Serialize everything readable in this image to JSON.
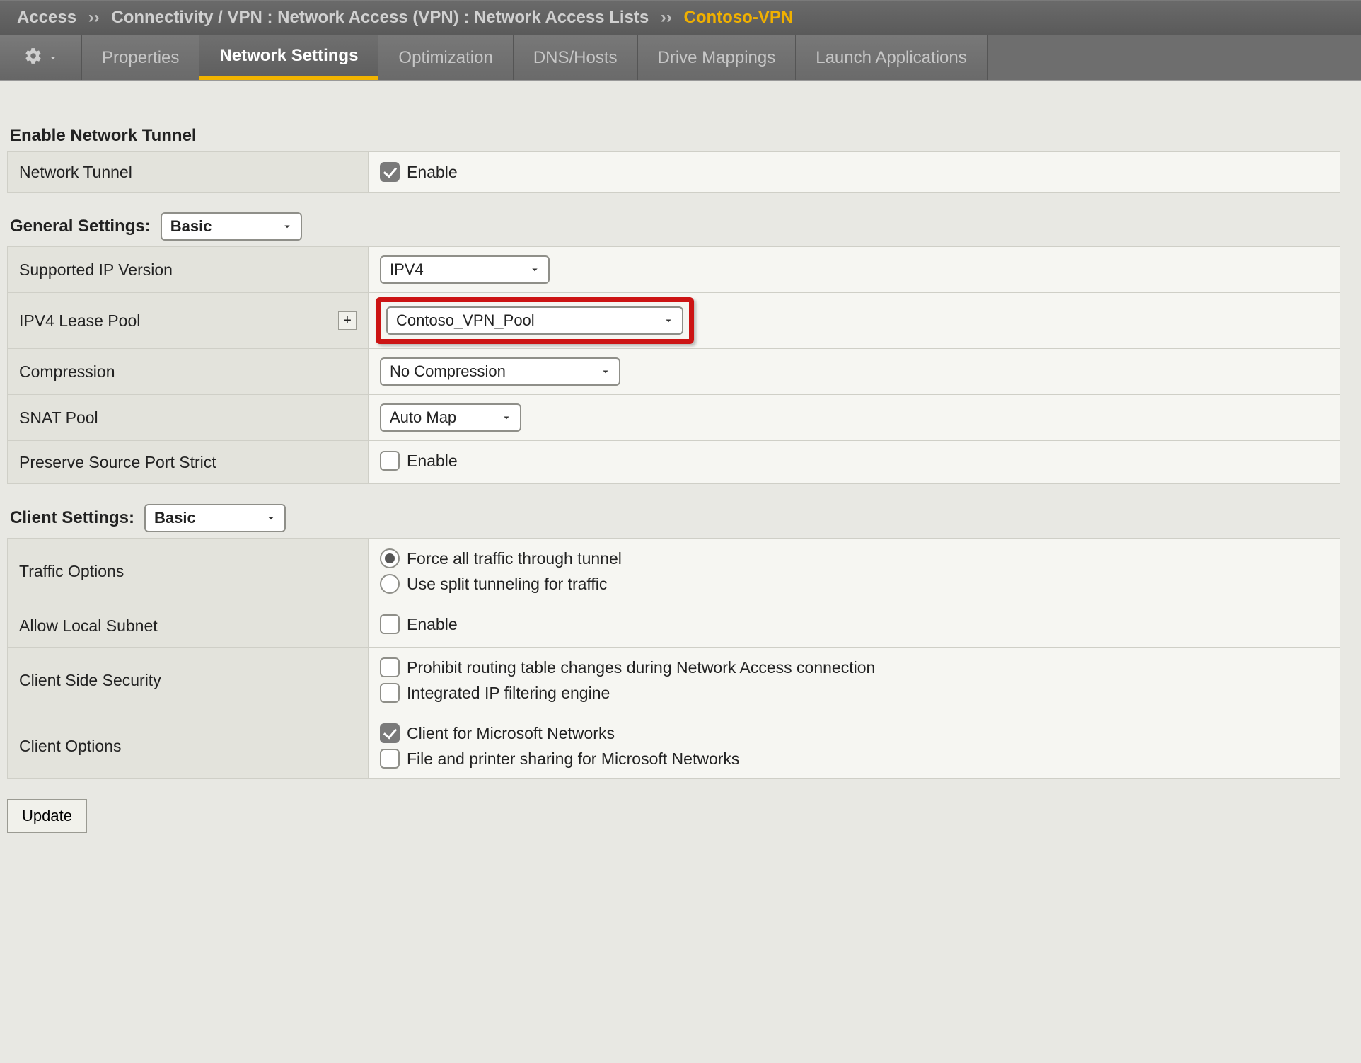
{
  "breadcrumb": {
    "root": "Access",
    "sep": "››",
    "path": "Connectivity / VPN : Network Access (VPN) : Network Access Lists",
    "current": "Contoso-VPN"
  },
  "tabs": [
    {
      "label": "Properties",
      "active": false
    },
    {
      "label": "Network Settings",
      "active": true
    },
    {
      "label": "Optimization",
      "active": false
    },
    {
      "label": "DNS/Hosts",
      "active": false
    },
    {
      "label": "Drive Mappings",
      "active": false
    },
    {
      "label": "Launch Applications",
      "active": false
    }
  ],
  "sections": {
    "enable_tunnel": {
      "title": "Enable Network Tunnel",
      "rows": {
        "network_tunnel": {
          "label": "Network Tunnel",
          "option": "Enable",
          "checked": true
        }
      }
    },
    "general": {
      "title": "General Settings:",
      "mode": "Basic",
      "rows": {
        "ip_version": {
          "label": "Supported IP Version",
          "value": "IPV4"
        },
        "lease_pool": {
          "label": "IPV4 Lease Pool",
          "value": "Contoso_VPN_Pool",
          "add": "+"
        },
        "compression": {
          "label": "Compression",
          "value": "No Compression"
        },
        "snat_pool": {
          "label": "SNAT Pool",
          "value": "Auto Map"
        },
        "preserve_src": {
          "label": "Preserve Source Port Strict",
          "option": "Enable",
          "checked": false
        }
      }
    },
    "client": {
      "title": "Client Settings:",
      "mode": "Basic",
      "rows": {
        "traffic": {
          "label": "Traffic Options",
          "options": [
            {
              "label": "Force all traffic through tunnel",
              "selected": true
            },
            {
              "label": "Use split tunneling for traffic",
              "selected": false
            }
          ]
        },
        "allow_local": {
          "label": "Allow Local Subnet",
          "option": "Enable",
          "checked": false
        },
        "security": {
          "label": "Client Side Security",
          "options": [
            {
              "label": "Prohibit routing table changes during Network Access connection",
              "checked": false
            },
            {
              "label": "Integrated IP filtering engine",
              "checked": false
            }
          ]
        },
        "client_opts": {
          "label": "Client Options",
          "options": [
            {
              "label": "Client for Microsoft Networks",
              "checked": true
            },
            {
              "label": "File and printer sharing for Microsoft Networks",
              "checked": false
            }
          ]
        }
      }
    }
  },
  "buttons": {
    "update": "Update"
  }
}
